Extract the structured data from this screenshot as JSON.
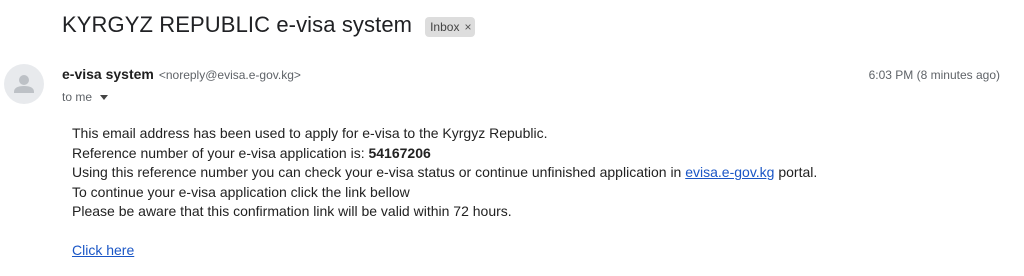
{
  "email": {
    "subject": "KYRGYZ REPUBLIC e-visa system",
    "label": "Inbox",
    "label_remove": "×",
    "sender_name": "e-visa system",
    "sender_email": "<noreply@evisa.e-gov.kg>",
    "timestamp": "6:03 PM (8 minutes ago)",
    "to": "to me",
    "avatar_icon": "person-icon"
  },
  "body": {
    "line1": "This email address has been used to apply for e-visa to the Kyrgyz Republic.",
    "line2_prefix": "Reference number of your e-visa application is: ",
    "reference_number": "54167206",
    "line3_prefix": "Using this reference number you can check your e-visa status or continue unfinished application in ",
    "portal_link": "evisa.e-gov.kg",
    "line3_suffix": " portal.",
    "line4": "To continue your e-visa application click the link bellow",
    "line5": "Please be aware that this confirmation link will be valid within 72 hours.",
    "click_link": "Click here"
  },
  "colors": {
    "link": "#1a56c6",
    "label_bg": "#dddddd",
    "avatar_bg": "#e8eaed"
  }
}
